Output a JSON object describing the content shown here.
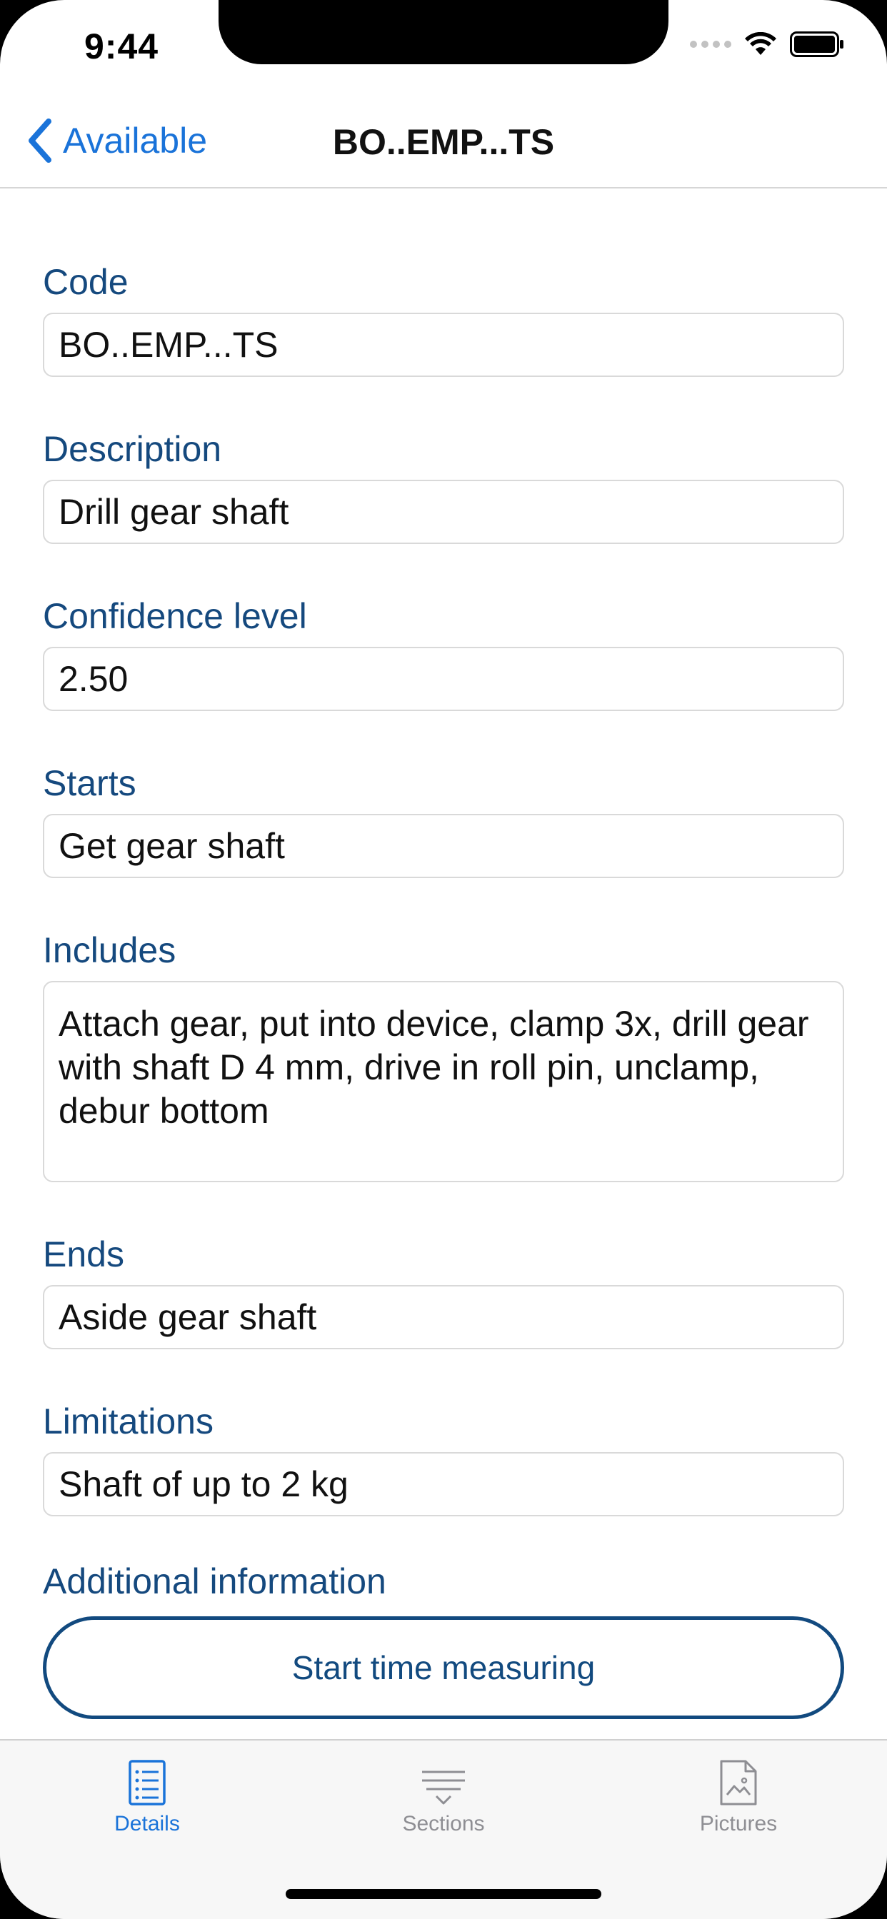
{
  "status_bar": {
    "time": "9:44"
  },
  "nav": {
    "back_label": "Available",
    "title": "BO..EMP...TS"
  },
  "fields": [
    {
      "label": "Code",
      "value": "BO..EMP...TS"
    },
    {
      "label": "Description",
      "value": "Drill gear shaft"
    },
    {
      "label": "Confidence level",
      "value": "2.50"
    },
    {
      "label": "Starts",
      "value": "Get gear shaft"
    },
    {
      "label": "Includes",
      "value": "Attach gear, put into device, clamp 3x, drill gear with shaft D 4 mm, drive in roll pin, unclamp, debur bottom"
    },
    {
      "label": "Ends",
      "value": "Aside gear shaft"
    },
    {
      "label": "Limitations",
      "value": "Shaft of up to 2 kg"
    }
  ],
  "additional_label": "Additional information",
  "start_button_label": "Start time measuring",
  "tabs": [
    {
      "label": "Details",
      "icon": "list-document-icon",
      "active": true
    },
    {
      "label": "Sections",
      "icon": "sections-filter-icon",
      "active": false
    },
    {
      "label": "Pictures",
      "icon": "picture-document-icon",
      "active": false
    }
  ],
  "colors": {
    "accent": "#1a73d9",
    "label": "#15497e",
    "button_border": "#124a7f",
    "inactive_tab": "#8e8e93"
  }
}
